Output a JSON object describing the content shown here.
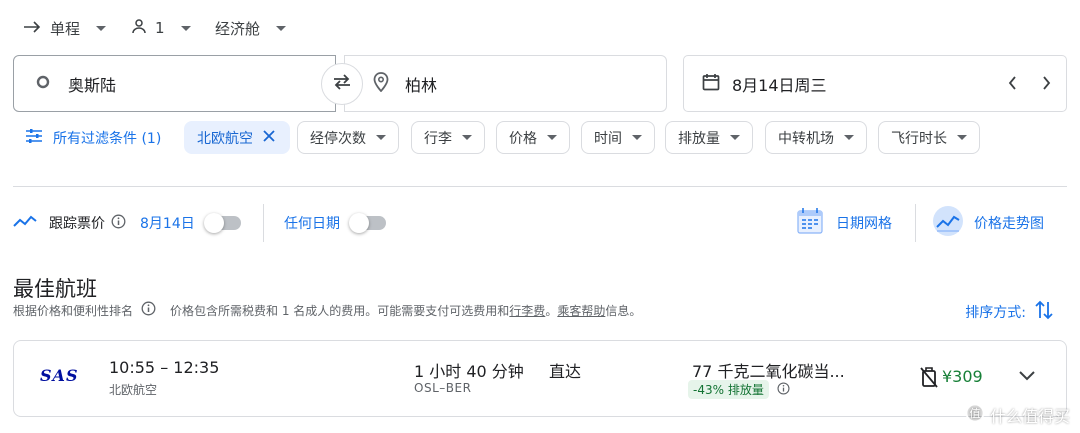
{
  "trip": {
    "type_label": "单程",
    "passengers": "1",
    "cabin": "经济舱"
  },
  "search": {
    "origin": "奥斯陆",
    "destination": "柏林",
    "date": "8月14日周三"
  },
  "filters": {
    "all_label": "所有过滤条件 (1)",
    "active_chip": "北欧航空",
    "chips": [
      "经停次数",
      "行李",
      "价格",
      "时间",
      "排放量",
      "中转机场",
      "飞行时长"
    ]
  },
  "tracking": {
    "label": "跟踪票价",
    "date_label": "8月14日",
    "any_date_label": "任何日期",
    "date_grid_label": "日期网格",
    "price_graph_label": "价格走势图"
  },
  "results": {
    "title": "最佳航班",
    "subtitle_rank": "根据价格和便利性排名",
    "subtitle_price_a": "价格包含所需税费和 1 名成人的费用。可能需要支付可选费用和",
    "baggage_link": "行李费",
    "subtitle_sep": "。",
    "help_link": "乘客帮助",
    "subtitle_end": "信息。",
    "sort_label": "排序方式:"
  },
  "flight": {
    "airline_logo": "SAS",
    "times": "10:55 – 12:35",
    "airline": "北欧航空",
    "duration": "1 小时 40 分钟",
    "route": "OSL–BER",
    "stops": "直达",
    "emissions": "77 千克二氧化碳当...",
    "emissions_badge": "-43% 排放量",
    "price": "¥309"
  },
  "watermark": {
    "text": "什么值得买"
  },
  "colors": {
    "accent": "#1a73e8",
    "price_green": "#188038",
    "sas_blue": "#000f9f"
  }
}
